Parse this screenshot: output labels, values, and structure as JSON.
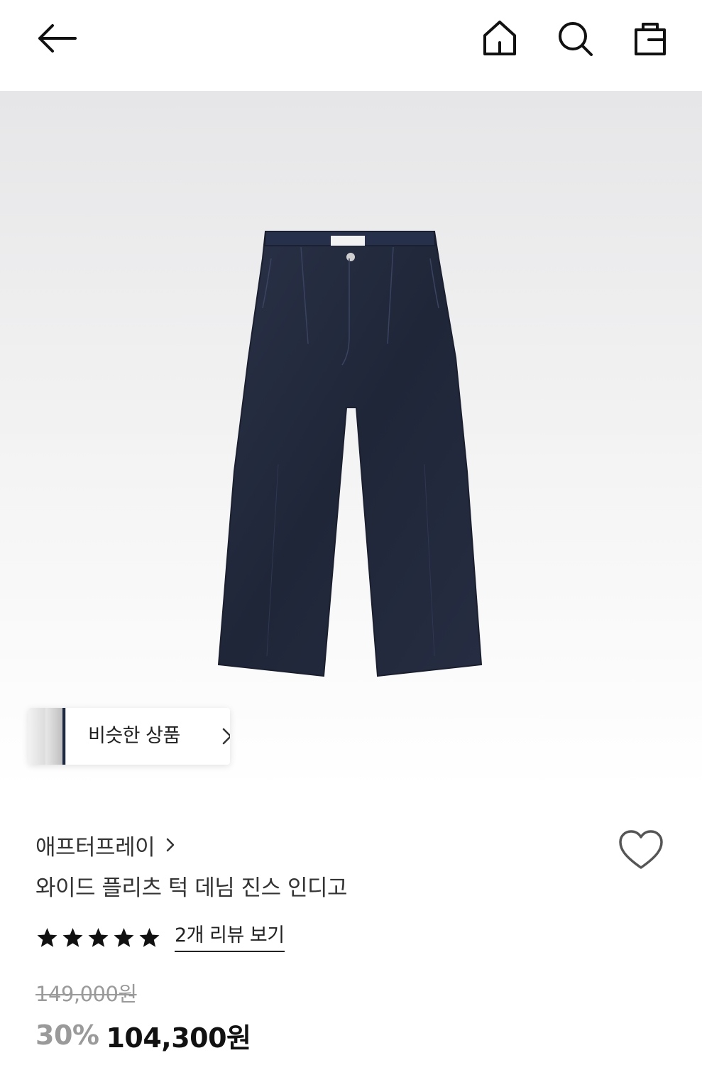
{
  "header": {
    "back_icon": "arrow-left-icon",
    "home_icon": "home-icon",
    "search_icon": "search-icon",
    "bag_icon": "shopping-bag-icon"
  },
  "similar": {
    "label": "비슷한 상품",
    "icon": "chevron-right-icon"
  },
  "product": {
    "brand": "애프터프레이",
    "title": "와이드 플리츠 턱 데님 진스 인디고",
    "rating": 5,
    "review_link": "2개 리뷰 보기",
    "original_price": "149,000원",
    "discount": "30%",
    "price": "104,300원",
    "wishlist_icon": "heart-outline-icon",
    "image_color": "#232b3f"
  }
}
